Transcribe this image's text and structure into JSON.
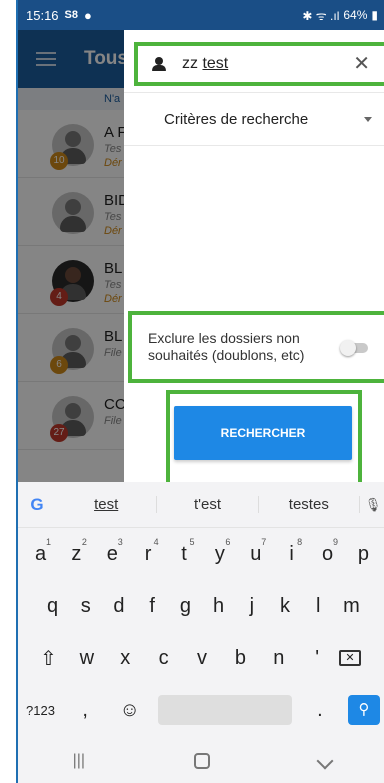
{
  "status_bar": {
    "time": "15:16",
    "battery": "64%"
  },
  "app": {
    "title": "Tous",
    "subtitle": "N'a",
    "rows": [
      {
        "name": "A F",
        "sub": "Tes",
        "sub2": "Dér",
        "badge": "10",
        "badge_color": "#d08a1a"
      },
      {
        "name": "BID",
        "sub": "Tes",
        "sub2": "Dér",
        "badge": "",
        "badge_color": ""
      },
      {
        "name": "BL",
        "sub": "Tes",
        "sub2": "Dér",
        "badge": "4",
        "badge_color": "#c0392b"
      },
      {
        "name": "BL",
        "sub": "File",
        "sub2": "",
        "badge": "6",
        "badge_color": "#d08a1a"
      },
      {
        "name": "CC",
        "sub": "File",
        "sub2": "",
        "badge": "27",
        "badge_color": "#c0392b"
      }
    ]
  },
  "search_panel": {
    "query_prefix": "zz ",
    "query_underlined": "test",
    "criteria_label": "Critères de recherche",
    "exclude_label": "Exclure les dossiers non souhaités (doublons, etc)",
    "exclude_enabled": false,
    "search_button_label": "RECHERCHER",
    "highlight_color": "#4db33c",
    "accent_color": "#1e88e5"
  },
  "keyboard": {
    "suggestions": [
      "test",
      "t'est",
      "testes"
    ],
    "row1": [
      {
        "k": "a",
        "n": "1"
      },
      {
        "k": "z",
        "n": "2"
      },
      {
        "k": "e",
        "n": "3"
      },
      {
        "k": "r",
        "n": "4"
      },
      {
        "k": "t",
        "n": "5"
      },
      {
        "k": "y",
        "n": "6"
      },
      {
        "k": "u",
        "n": "7"
      },
      {
        "k": "i",
        "n": "8"
      },
      {
        "k": "o",
        "n": "9"
      },
      {
        "k": "p",
        "n": ""
      }
    ],
    "row2": [
      "q",
      "s",
      "d",
      "f",
      "g",
      "h",
      "j",
      "k",
      "l",
      "m"
    ],
    "row3": [
      "w",
      "x",
      "c",
      "v",
      "b",
      "n",
      "'"
    ],
    "symbols_label": "?123",
    "comma": ",",
    "period": "."
  }
}
